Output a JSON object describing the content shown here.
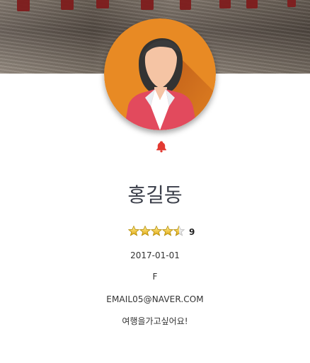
{
  "profile": {
    "name": "홍길동",
    "rating_count": "9",
    "birth_date": "2017-01-01",
    "gender": "F",
    "email": "EMAIL05@NAVER.COM",
    "bio": "여행을가고싶어요!"
  },
  "rating": {
    "stars": 4.5,
    "max_stars": 5
  },
  "icons": {
    "notification": "bell-icon",
    "rating": "star-icon",
    "avatar": "user-avatar-icon"
  },
  "colors": {
    "avatar_bg": "#e88a24",
    "jacket": "#e24a5d",
    "bell": "#e33a32",
    "star": "#f2b705",
    "name_text": "#3b3f4a"
  }
}
